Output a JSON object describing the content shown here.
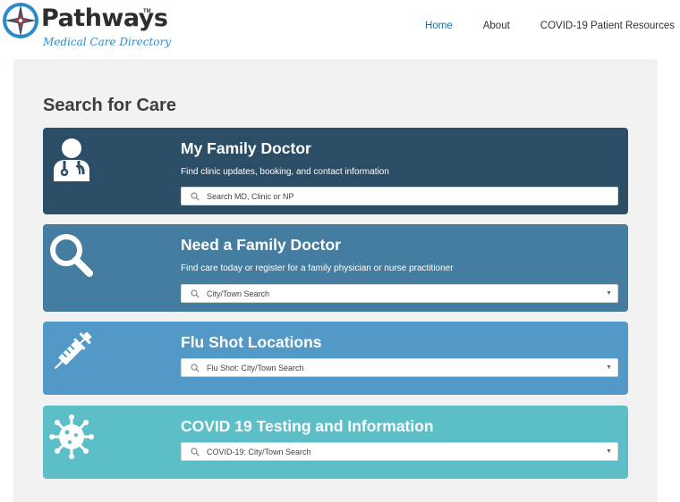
{
  "brand": {
    "name": "Pathways",
    "tm": "TM",
    "subtitle": "Medical Care Directory",
    "colors": {
      "accent": "#2e8bc9",
      "star_dark": "#2b4e66"
    }
  },
  "nav": {
    "items": [
      {
        "label": "Home",
        "active": true
      },
      {
        "label": "About",
        "active": false
      },
      {
        "label": "COVID-19 Patient Resources",
        "active": false
      }
    ]
  },
  "main": {
    "title": "Search for Care",
    "cards": [
      {
        "title": "My Family Doctor",
        "description": "Find clinic updates, booking, and contact information",
        "search_placeholder": "Search MD, Clinic or NP",
        "icon": "doctor-icon",
        "color": "#2b4e66",
        "has_dropdown": false
      },
      {
        "title": "Need a Family Doctor",
        "description": "Find care today or register for a family physician or nurse practitioner",
        "search_placeholder": "City/Town Search",
        "icon": "magnifier-icon",
        "color": "#447d9f",
        "has_dropdown": true
      },
      {
        "title": "Flu Shot Locations",
        "search_placeholder": "Flu Shot: City/Town Search",
        "icon": "syringe-icon",
        "color": "#5399c8",
        "has_dropdown": true
      },
      {
        "title": "COVID 19 Testing and Information",
        "search_placeholder": "COVID-19: City/Town Search",
        "icon": "virus-icon",
        "color": "#5cbfc7",
        "has_dropdown": true
      }
    ]
  }
}
